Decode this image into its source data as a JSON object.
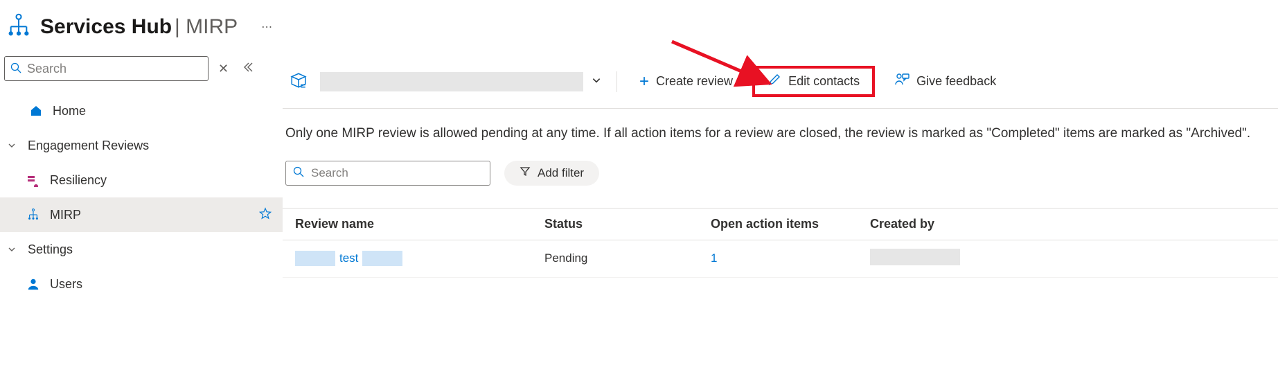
{
  "header": {
    "title": "Services Hub",
    "sub": "MIRP"
  },
  "sidebar": {
    "search_placeholder": "Search",
    "items": [
      {
        "label": "Home"
      },
      {
        "label": "Engagement Reviews"
      },
      {
        "label": "Resiliency"
      },
      {
        "label": "MIRP"
      },
      {
        "label": "Settings"
      },
      {
        "label": "Users"
      }
    ]
  },
  "actions": {
    "create_review": "Create review",
    "edit_contacts": "Edit contacts",
    "give_feedback": "Give feedback"
  },
  "description": "Only one MIRP review is allowed pending at any time. If all action items for a review are closed, the review is marked as \"Completed\" items are marked as \"Archived\".",
  "filters": {
    "search_placeholder": "Search",
    "add_filter": "Add filter"
  },
  "table": {
    "headers": {
      "review_name": "Review name",
      "status": "Status",
      "open_items": "Open action items",
      "created_by": "Created by"
    },
    "rows": [
      {
        "review_name": "test",
        "status": "Pending",
        "open_items": "1"
      }
    ]
  }
}
